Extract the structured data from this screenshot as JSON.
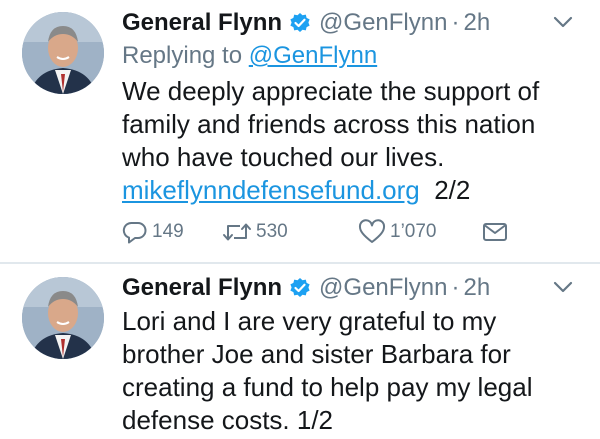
{
  "tweets": [
    {
      "author_name": "General Flynn",
      "handle": "@GenFlynn",
      "separator": "·",
      "time": "2h",
      "reply_prefix": "Replying to",
      "reply_handle": "@GenFlynn",
      "text_lines": [
        "We deeply appreciate the support of",
        "family and friends across this nation",
        "who have touched our lives."
      ],
      "link_text": "mikeflynndefensefund.org",
      "link_suffix": "2/2",
      "reply_count": "149",
      "retweet_count": "530",
      "like_count": "1’070"
    },
    {
      "author_name": "General Flynn",
      "handle": "@GenFlynn",
      "separator": "·",
      "time": "2h",
      "text_lines": [
        "Lori and I are very grateful to my",
        "brother Joe and sister Barbara for",
        "creating a fund to help pay my legal",
        "defense costs. 1/2"
      ]
    }
  ],
  "colors": {
    "link": "#1b95e0",
    "secondary_text": "#657786",
    "verified_badge": "#1da1f2",
    "divider": "#e1e8ed"
  },
  "icons": [
    "verified-badge-icon",
    "chevron-down-icon",
    "reply-icon",
    "retweet-icon",
    "heart-icon",
    "envelope-icon"
  ]
}
